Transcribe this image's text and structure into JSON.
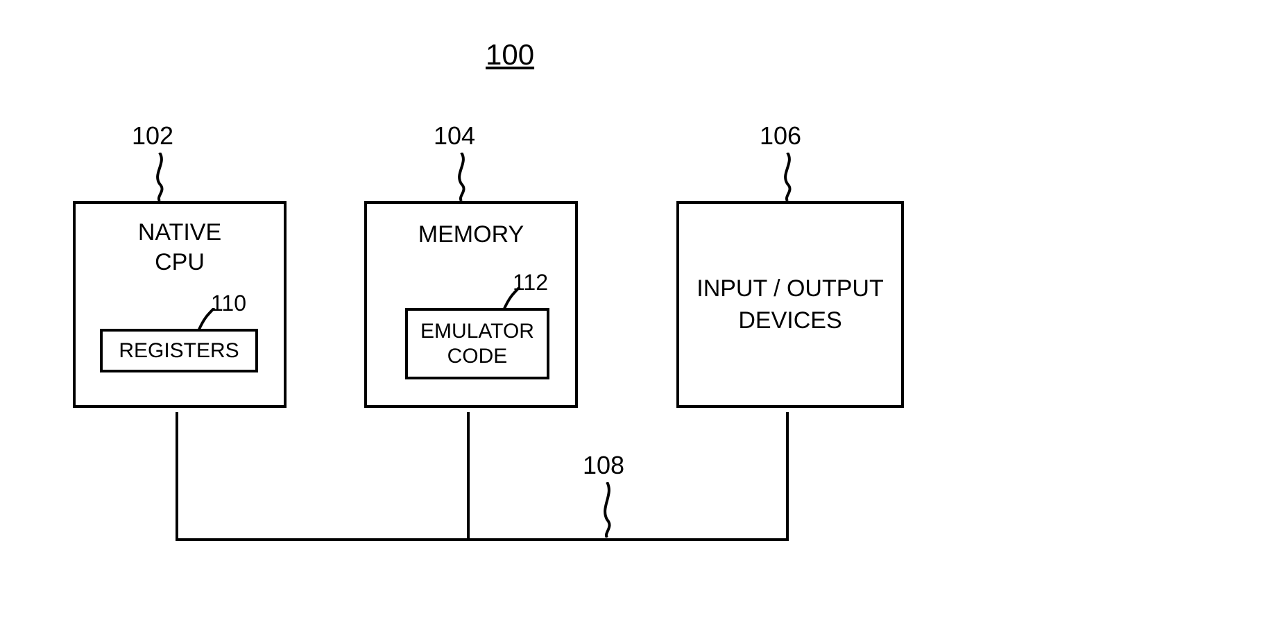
{
  "title": "100",
  "cpu": {
    "ref": "102",
    "label_l1": "NATIVE",
    "label_l2": "CPU",
    "inner": {
      "ref": "110",
      "label": "REGISTERS"
    }
  },
  "mem": {
    "ref": "104",
    "label": "MEMORY",
    "inner": {
      "ref": "112",
      "label_l1": "EMULATOR",
      "label_l2": "CODE"
    }
  },
  "io": {
    "ref": "106",
    "label_l1": "INPUT / OUTPUT",
    "label_l2": "DEVICES"
  },
  "bus": {
    "ref": "108"
  }
}
